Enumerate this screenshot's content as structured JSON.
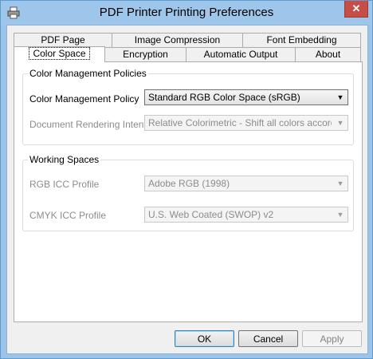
{
  "window": {
    "title": "PDF Printer Printing Preferences",
    "close_label": "✕",
    "icon": "printer-icon"
  },
  "tabs_row1": [
    {
      "label": "PDF Page"
    },
    {
      "label": "Image Compression"
    },
    {
      "label": "Font Embedding"
    }
  ],
  "tabs_row2": [
    {
      "label": "Color Space",
      "active": true
    },
    {
      "label": "Encryption"
    },
    {
      "label": "Automatic Output"
    },
    {
      "label": "About"
    }
  ],
  "color_management": {
    "group_title": "Color Management Policies",
    "policy_label": "Color Management Policy",
    "policy_value": "Standard RGB Color Space (sRGB)",
    "intent_label": "Document Rendering Intent",
    "intent_value": "Relative Colorimetric - Shift all colors accordingly a"
  },
  "working_spaces": {
    "group_title": "Working Spaces",
    "rgb_label": "RGB ICC Profile",
    "rgb_value": "Adobe RGB (1998)",
    "cmyk_label": "CMYK ICC Profile",
    "cmyk_value": "U.S. Web Coated (SWOP) v2"
  },
  "buttons": {
    "ok": "OK",
    "cancel": "Cancel",
    "apply": "Apply"
  },
  "colors": {
    "titlebar": "#9ec6ea",
    "close": "#c74d47",
    "accent_border": "#3c7fb1"
  }
}
